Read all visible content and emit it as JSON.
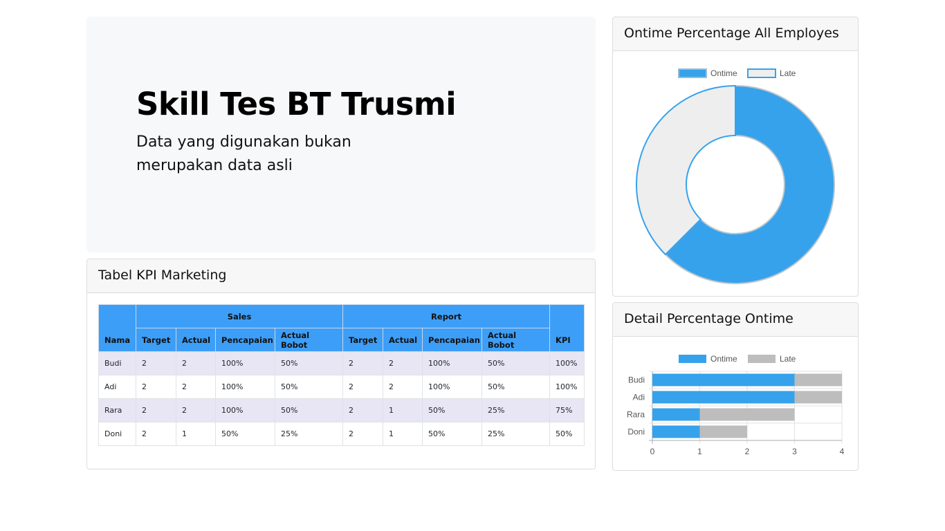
{
  "hero": {
    "title": "Skill Tes BT Trusmi",
    "subtitle": "Data yang digunakan bukan merupakan data asli"
  },
  "kpi_card": {
    "title": "Tabel KPI Marketing",
    "group_headers": {
      "sales": "Sales",
      "report": "Report"
    },
    "columns": {
      "nama": "Nama",
      "sales_target": "Target",
      "sales_actual": "Actual",
      "sales_pencapaian": "Pencapaian",
      "sales_actual_bobot": "Actual Bobot",
      "report_target": "Target",
      "report_actual": "Actual",
      "report_pencapaian": "Pencapaian",
      "report_actual_bobot": "Actual Bobot",
      "kpi": "KPI"
    },
    "rows": [
      [
        "Budi",
        "2",
        "2",
        "100%",
        "50%",
        "2",
        "2",
        "100%",
        "50%",
        "100%"
      ],
      [
        "Adi",
        "2",
        "2",
        "100%",
        "50%",
        "2",
        "2",
        "100%",
        "50%",
        "100%"
      ],
      [
        "Rara",
        "2",
        "2",
        "100%",
        "50%",
        "2",
        "1",
        "50%",
        "25%",
        "75%"
      ],
      [
        "Doni",
        "2",
        "1",
        "50%",
        "25%",
        "2",
        "1",
        "50%",
        "25%",
        "50%"
      ]
    ]
  },
  "donut_card": {
    "title": "Ontime Percentage All Employes"
  },
  "bar_card": {
    "title": "Detail Percentage Ontime"
  },
  "chart_data": [
    {
      "type": "pie",
      "variant": "doughnut",
      "labels": [
        "Ontime",
        "Late"
      ],
      "values": [
        10,
        6
      ],
      "colors": [
        "#36a2eb",
        "#eeeeee"
      ],
      "legend": "top"
    },
    {
      "type": "bar",
      "orientation": "horizontal",
      "stacked": true,
      "categories": [
        "Budi",
        "Adi",
        "Rara",
        "Doni"
      ],
      "series": [
        {
          "name": "Ontime",
          "values": [
            3,
            3,
            1,
            1
          ],
          "color": "#36a2eb"
        },
        {
          "name": "Late",
          "values": [
            1,
            1,
            2,
            1
          ],
          "color": "#bdbdbd"
        }
      ],
      "xlim": [
        0,
        4
      ],
      "xticks": [
        "0",
        "1",
        "2",
        "3",
        "4"
      ],
      "legend": "top",
      "grid": true
    }
  ]
}
